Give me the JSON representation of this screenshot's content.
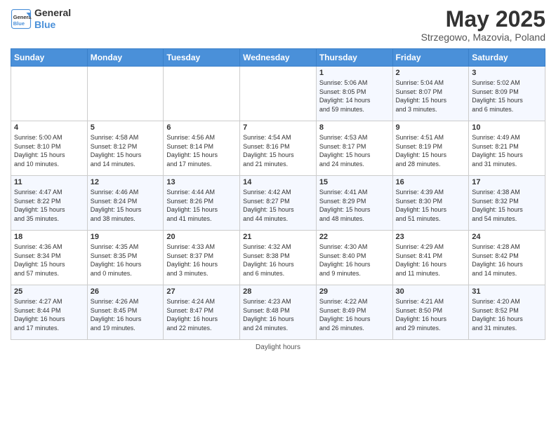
{
  "header": {
    "logo_line1": "General",
    "logo_line2": "Blue",
    "month_title": "May 2025",
    "subtitle": "Strzegowo, Mazovia, Poland"
  },
  "weekdays": [
    "Sunday",
    "Monday",
    "Tuesday",
    "Wednesday",
    "Thursday",
    "Friday",
    "Saturday"
  ],
  "weeks": [
    [
      {
        "day": "",
        "info": ""
      },
      {
        "day": "",
        "info": ""
      },
      {
        "day": "",
        "info": ""
      },
      {
        "day": "",
        "info": ""
      },
      {
        "day": "1",
        "info": "Sunrise: 5:06 AM\nSunset: 8:05 PM\nDaylight: 14 hours\nand 59 minutes."
      },
      {
        "day": "2",
        "info": "Sunrise: 5:04 AM\nSunset: 8:07 PM\nDaylight: 15 hours\nand 3 minutes."
      },
      {
        "day": "3",
        "info": "Sunrise: 5:02 AM\nSunset: 8:09 PM\nDaylight: 15 hours\nand 6 minutes."
      }
    ],
    [
      {
        "day": "4",
        "info": "Sunrise: 5:00 AM\nSunset: 8:10 PM\nDaylight: 15 hours\nand 10 minutes."
      },
      {
        "day": "5",
        "info": "Sunrise: 4:58 AM\nSunset: 8:12 PM\nDaylight: 15 hours\nand 14 minutes."
      },
      {
        "day": "6",
        "info": "Sunrise: 4:56 AM\nSunset: 8:14 PM\nDaylight: 15 hours\nand 17 minutes."
      },
      {
        "day": "7",
        "info": "Sunrise: 4:54 AM\nSunset: 8:16 PM\nDaylight: 15 hours\nand 21 minutes."
      },
      {
        "day": "8",
        "info": "Sunrise: 4:53 AM\nSunset: 8:17 PM\nDaylight: 15 hours\nand 24 minutes."
      },
      {
        "day": "9",
        "info": "Sunrise: 4:51 AM\nSunset: 8:19 PM\nDaylight: 15 hours\nand 28 minutes."
      },
      {
        "day": "10",
        "info": "Sunrise: 4:49 AM\nSunset: 8:21 PM\nDaylight: 15 hours\nand 31 minutes."
      }
    ],
    [
      {
        "day": "11",
        "info": "Sunrise: 4:47 AM\nSunset: 8:22 PM\nDaylight: 15 hours\nand 35 minutes."
      },
      {
        "day": "12",
        "info": "Sunrise: 4:46 AM\nSunset: 8:24 PM\nDaylight: 15 hours\nand 38 minutes."
      },
      {
        "day": "13",
        "info": "Sunrise: 4:44 AM\nSunset: 8:26 PM\nDaylight: 15 hours\nand 41 minutes."
      },
      {
        "day": "14",
        "info": "Sunrise: 4:42 AM\nSunset: 8:27 PM\nDaylight: 15 hours\nand 44 minutes."
      },
      {
        "day": "15",
        "info": "Sunrise: 4:41 AM\nSunset: 8:29 PM\nDaylight: 15 hours\nand 48 minutes."
      },
      {
        "day": "16",
        "info": "Sunrise: 4:39 AM\nSunset: 8:30 PM\nDaylight: 15 hours\nand 51 minutes."
      },
      {
        "day": "17",
        "info": "Sunrise: 4:38 AM\nSunset: 8:32 PM\nDaylight: 15 hours\nand 54 minutes."
      }
    ],
    [
      {
        "day": "18",
        "info": "Sunrise: 4:36 AM\nSunset: 8:34 PM\nDaylight: 15 hours\nand 57 minutes."
      },
      {
        "day": "19",
        "info": "Sunrise: 4:35 AM\nSunset: 8:35 PM\nDaylight: 16 hours\nand 0 minutes."
      },
      {
        "day": "20",
        "info": "Sunrise: 4:33 AM\nSunset: 8:37 PM\nDaylight: 16 hours\nand 3 minutes."
      },
      {
        "day": "21",
        "info": "Sunrise: 4:32 AM\nSunset: 8:38 PM\nDaylight: 16 hours\nand 6 minutes."
      },
      {
        "day": "22",
        "info": "Sunrise: 4:30 AM\nSunset: 8:40 PM\nDaylight: 16 hours\nand 9 minutes."
      },
      {
        "day": "23",
        "info": "Sunrise: 4:29 AM\nSunset: 8:41 PM\nDaylight: 16 hours\nand 11 minutes."
      },
      {
        "day": "24",
        "info": "Sunrise: 4:28 AM\nSunset: 8:42 PM\nDaylight: 16 hours\nand 14 minutes."
      }
    ],
    [
      {
        "day": "25",
        "info": "Sunrise: 4:27 AM\nSunset: 8:44 PM\nDaylight: 16 hours\nand 17 minutes."
      },
      {
        "day": "26",
        "info": "Sunrise: 4:26 AM\nSunset: 8:45 PM\nDaylight: 16 hours\nand 19 minutes."
      },
      {
        "day": "27",
        "info": "Sunrise: 4:24 AM\nSunset: 8:47 PM\nDaylight: 16 hours\nand 22 minutes."
      },
      {
        "day": "28",
        "info": "Sunrise: 4:23 AM\nSunset: 8:48 PM\nDaylight: 16 hours\nand 24 minutes."
      },
      {
        "day": "29",
        "info": "Sunrise: 4:22 AM\nSunset: 8:49 PM\nDaylight: 16 hours\nand 26 minutes."
      },
      {
        "day": "30",
        "info": "Sunrise: 4:21 AM\nSunset: 8:50 PM\nDaylight: 16 hours\nand 29 minutes."
      },
      {
        "day": "31",
        "info": "Sunrise: 4:20 AM\nSunset: 8:52 PM\nDaylight: 16 hours\nand 31 minutes."
      }
    ]
  ],
  "footer": {
    "daylight_label": "Daylight hours"
  }
}
